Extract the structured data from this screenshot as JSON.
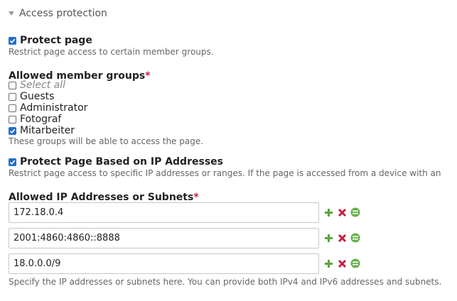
{
  "legend": {
    "title": "Access protection"
  },
  "protect_page": {
    "label": "Protect page",
    "checked": true,
    "help": "Restrict page access to certain member groups."
  },
  "groups": {
    "label": "Allowed member groups",
    "required_mark": "*",
    "select_all": "Select all",
    "options": [
      {
        "label": "Guests",
        "checked": false
      },
      {
        "label": "Administrator",
        "checked": false
      },
      {
        "label": "Fotograf",
        "checked": false
      },
      {
        "label": "Mitarbeiter",
        "checked": true
      }
    ],
    "help": "These groups will be able to access the page."
  },
  "protect_ip": {
    "label": "Protect Page Based on IP Addresses",
    "checked": true,
    "help": "Restrict page access to specific IP addresses or ranges. If the page is accessed from a device with an"
  },
  "ips": {
    "label": "Allowed IP Addresses or Subnets",
    "required_mark": "*",
    "rows": [
      {
        "value": "172.18.0.4"
      },
      {
        "value": "2001:4860:4860::8888"
      },
      {
        "value": "18.0.0.0/9"
      }
    ],
    "help": "Specify the IP addresses or subnets here. You can provide both IPv4 and IPv6 addresses and subnets."
  },
  "colors": {
    "accent": "#1f6fd1",
    "add": "#5aa53b",
    "delete": "#c5203f",
    "drag": "#6ab04c"
  }
}
